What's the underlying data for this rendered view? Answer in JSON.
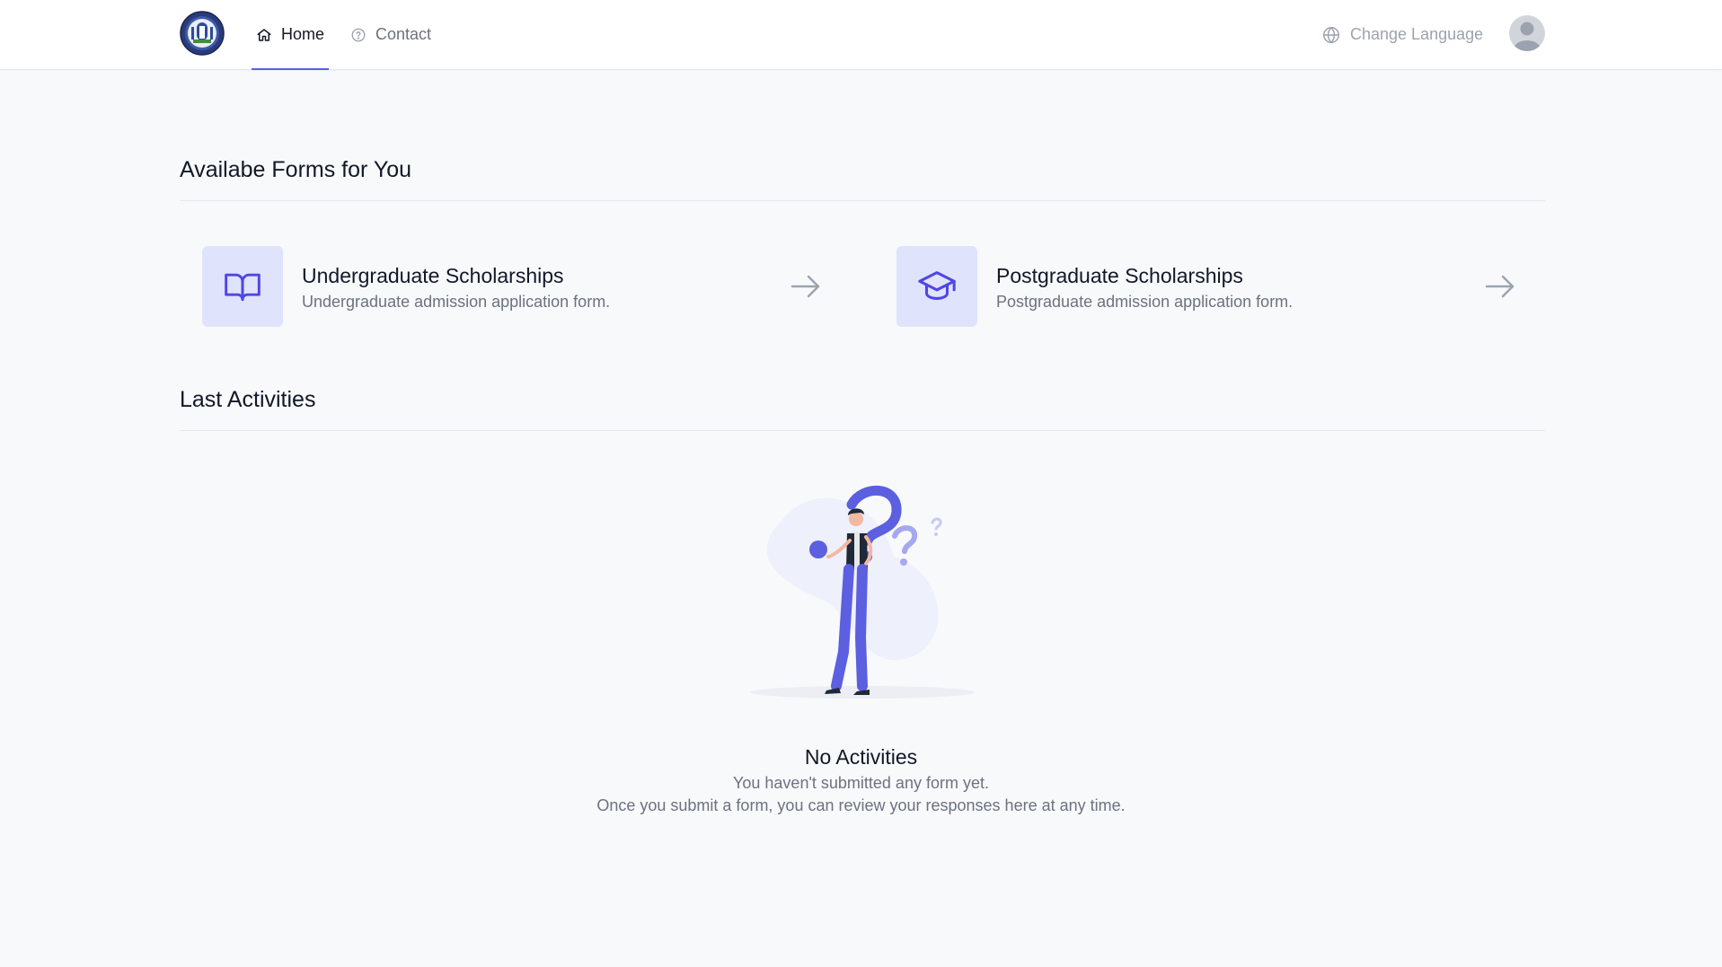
{
  "nav": {
    "home_label": "Home",
    "contact_label": "Contact",
    "language_label": "Change Language"
  },
  "forms_section": {
    "title": "Availabe Forms for You",
    "cards": [
      {
        "title": "Undergraduate Scholarships",
        "description": "Undergraduate admission application form.",
        "icon": "book-open-icon"
      },
      {
        "title": "Postgraduate Scholarships",
        "description": "Postgraduate admission application form.",
        "icon": "graduation-cap-icon"
      }
    ]
  },
  "activities_section": {
    "title": "Last Activities",
    "empty_title": "No Activities",
    "empty_line1": "You haven't submitted any form yet.",
    "empty_line2": "Once you submit a form, you can review your responses here at any time."
  },
  "colors": {
    "accent": "#5b5fe0",
    "icon_bg": "#e0e3fc",
    "page_bg": "#f8f9fb"
  }
}
